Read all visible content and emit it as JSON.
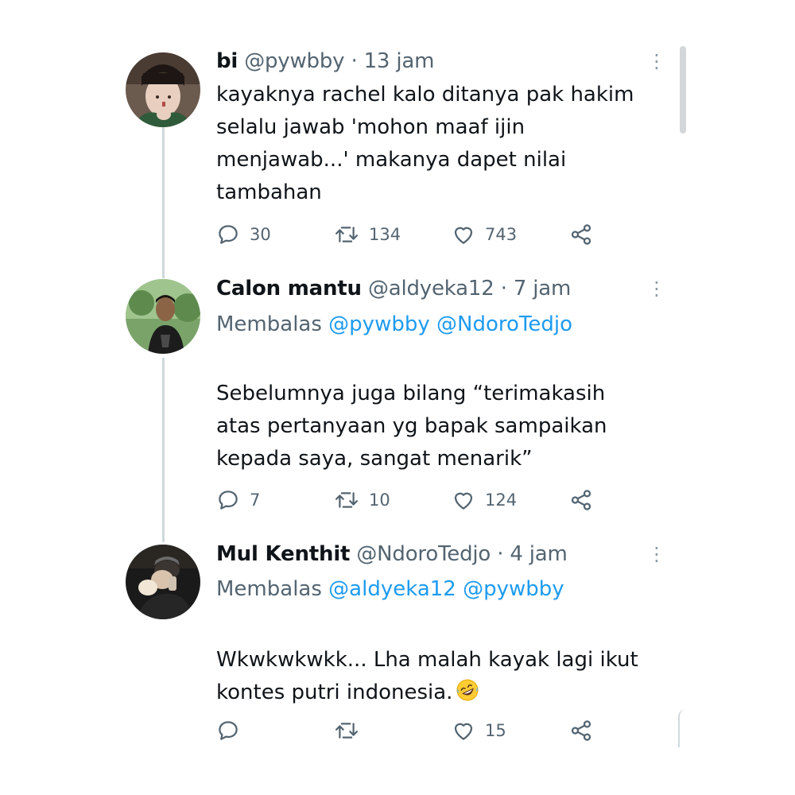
{
  "tweets": [
    {
      "name": "bi",
      "handle": "@pywbby",
      "sep": "·",
      "time": "13 jam",
      "body_lines": [
        "kayaknya rachel kalo ditanya pak hakim",
        "selalu jawab 'mohon maaf ijin",
        "menjawab...' makanya dapet nilai",
        "tambahan"
      ],
      "replies": "30",
      "retweets": "134",
      "likes": "743"
    },
    {
      "name": "Calon mantu",
      "handle": "@aldyeka12",
      "sep": "·",
      "time": "7 jam",
      "reply_label": "Membalas",
      "reply_mentions": [
        "@pywbby",
        "@NdoroTedjo"
      ],
      "body_lines": [
        "Sebelumnya juga bilang “terimakasih",
        "atas pertanyaan yg bapak sampaikan",
        "kepada saya, sangat menarik”"
      ],
      "replies": "7",
      "retweets": "10",
      "likes": "124"
    },
    {
      "name": "Mul Kenthit",
      "handle": "@NdoroTedjo",
      "sep": "·",
      "time": "4 jam",
      "reply_label": "Membalas",
      "reply_mentions": [
        "@aldyeka12",
        "@pywbby"
      ],
      "body_lines": [
        "Wkwkwkwkk... Lha malah kayak lagi ikut",
        "kontes putri indonesia."
      ],
      "emoji": "rolling-on-floor-laughing",
      "replies": "",
      "retweets": "",
      "likes": "15"
    }
  ],
  "icons": {
    "reply": "reply-icon",
    "retweet": "retweet-icon",
    "like": "heart-icon",
    "share": "share-icon",
    "more": "more-vertical-icon"
  },
  "colors": {
    "text": "#0f1419",
    "muted": "#536471",
    "mention": "#1d9bf0",
    "thread_line": "#cfd9de"
  }
}
